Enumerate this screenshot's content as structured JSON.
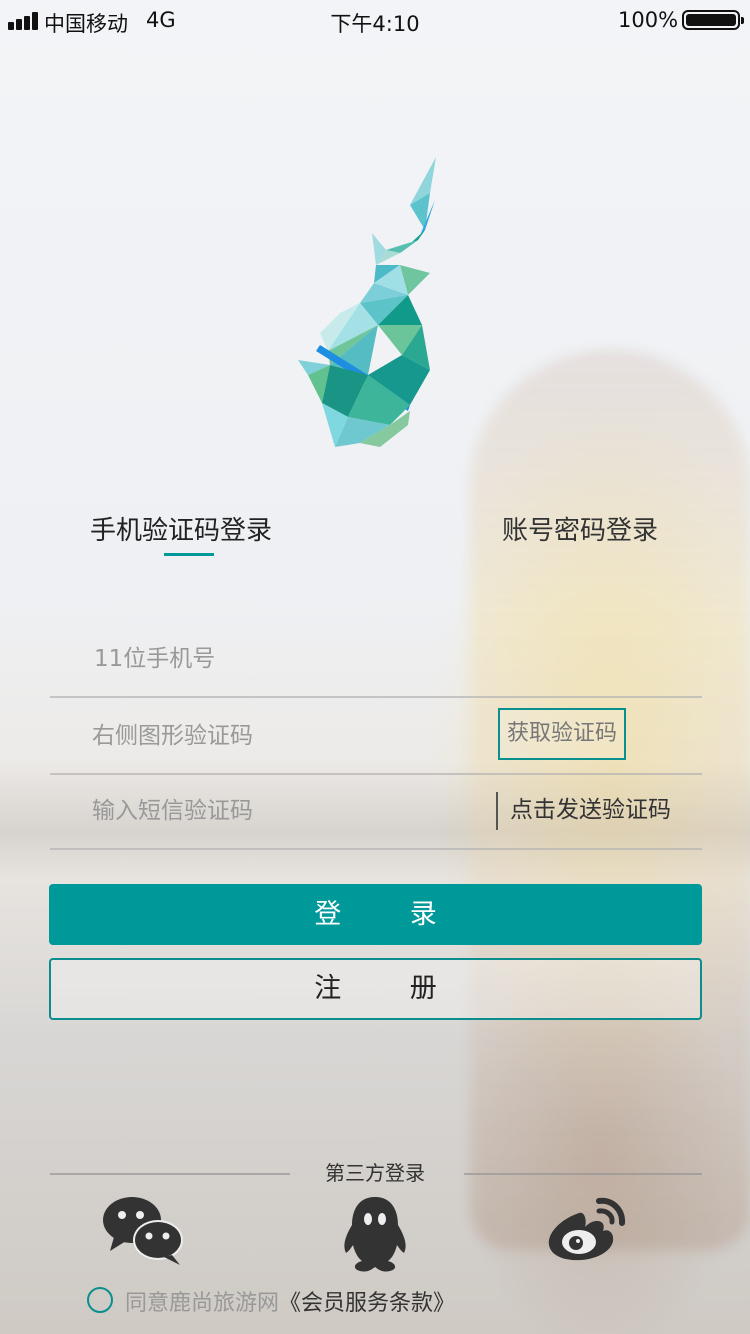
{
  "status_bar": {
    "carrier": "中国移动",
    "network": "4G",
    "time": "下午4:10",
    "battery": "100%"
  },
  "tabs": [
    {
      "label": "手机验证码登录",
      "active": true
    },
    {
      "label": "账号密码登录",
      "active": false
    }
  ],
  "form": {
    "phone_placeholder": "11位手机号",
    "captcha_placeholder": "右侧图形验证码",
    "captcha_button": "获取验证码",
    "sms_placeholder": "输入短信验证码",
    "send_sms_button": "点击发送验证码"
  },
  "buttons": {
    "login": "登 录",
    "register": "注 册"
  },
  "third_party": {
    "title": "第三方登录",
    "providers": [
      "wechat-icon",
      "qq-icon",
      "weibo-icon"
    ]
  },
  "agreement": {
    "text": "同意鹿尚旅游网",
    "link": "《会员服务条款》"
  },
  "colors": {
    "accent": "#00999a"
  }
}
